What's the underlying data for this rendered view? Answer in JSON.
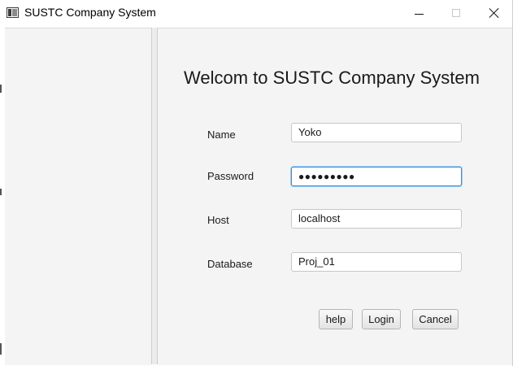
{
  "window": {
    "title": "SUSTC Company System",
    "app_icon": "window-app-icon",
    "controls": {
      "minimize_icon": "minimize-icon",
      "maximize_icon": "maximize-icon",
      "close_icon": "close-icon"
    }
  },
  "login": {
    "heading": "Welcom to SUSTC Company System",
    "fields": {
      "name": {
        "label": "Name",
        "value": "Yoko"
      },
      "password": {
        "label": "Password",
        "value": "●●●●●●●●●"
      },
      "host": {
        "label": "Host",
        "value": "localhost"
      },
      "database": {
        "label": "Database",
        "value": "Proj_01"
      }
    },
    "buttons": {
      "help": "help",
      "login": "Login",
      "cancel": "Cancel"
    },
    "focus_color": "#3c90d6"
  }
}
